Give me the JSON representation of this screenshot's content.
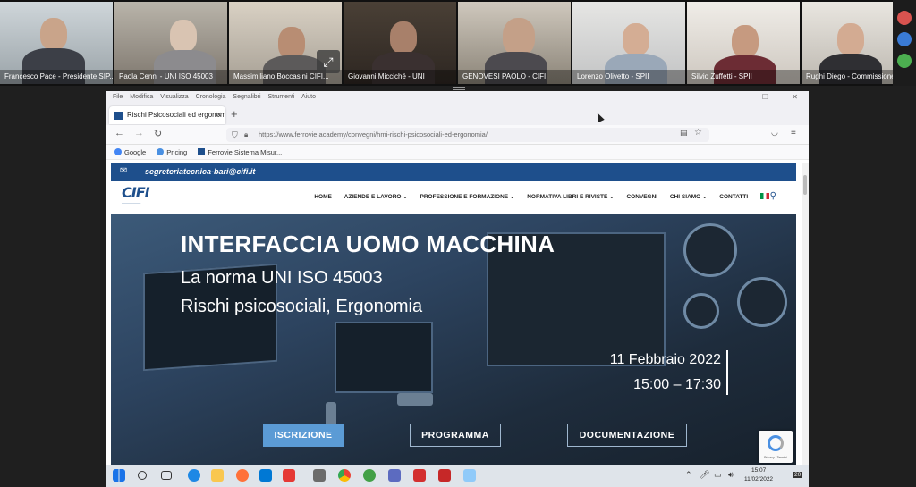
{
  "participants": [
    {
      "name": "Francesco Pace - Presidente SIP..."
    },
    {
      "name": "Paola Cenni - UNI ISO 45003"
    },
    {
      "name": "Massimiliano Boccasini CIFI..."
    },
    {
      "name": "Giovanni Micciché - UNI"
    },
    {
      "name": "GENOVESI PAOLO - CIFI"
    },
    {
      "name": "Lorenzo Olivetto - SPII"
    },
    {
      "name": "Silvio Zuffetti - SPII"
    },
    {
      "name": "Rughi Diego - Commissione UN..."
    }
  ],
  "browser": {
    "menu": [
      "File",
      "Modifica",
      "Visualizza",
      "Cronologia",
      "Segnalibri",
      "Strumenti",
      "Aiuto"
    ],
    "tab_title": "Rischi Psicosociali ed ergonomia",
    "new_tab": "+",
    "url": "https://www.ferrovie.academy/convegni/hmi-rischi-psicosociali-ed-ergonomia/",
    "bookmarks": [
      "Google",
      "Pricing",
      "Ferrovie Sistema Misur..."
    ]
  },
  "site": {
    "email": "segreteriatecnica-bari@cifi.it",
    "logo_text": "CIFI",
    "nav": [
      "HOME",
      "AZIENDE E LAVORO ⌄",
      "PROFESSIONE E FORMAZIONE ⌄",
      "NORMATIVA LIBRI E RIVISTE ⌄",
      "CONVEGNI",
      "CHI SIAMO ⌄",
      "CONTATTI"
    ],
    "hero_title": "INTERFACCIA UOMO MACCHINA",
    "hero_sub1": "La norma UNI ISO 45003",
    "hero_sub2": "Rischi psicosociali, Ergonomia",
    "date": "11 Febbraio 2022",
    "time": "15:00 – 17:30",
    "buttons": [
      "ISCRIZIONE",
      "PROGRAMMA",
      "DOCUMENTAZIONE"
    ],
    "recaptcha": "Privacy - Termini"
  },
  "taskbar": {
    "clock_time": "15:07",
    "clock_date": "11/02/2022",
    "badge": "20"
  },
  "colors": {
    "brand_blue": "#1e4f8c",
    "active_speaker": "#3cb371",
    "cta_primary": "#5b9bd5"
  }
}
